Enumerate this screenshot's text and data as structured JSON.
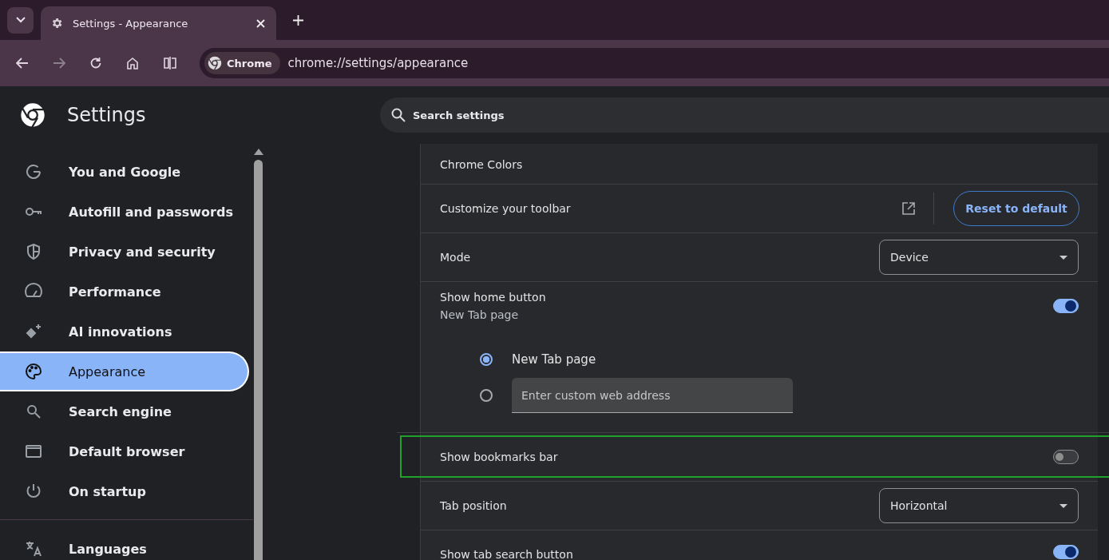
{
  "tab_strip": {
    "tabs": [
      {
        "title": "Settings - Appearance",
        "selected": true
      }
    ]
  },
  "toolbar": {
    "site_chip": "Chrome",
    "url": "chrome://settings/appearance"
  },
  "header": {
    "title": "Settings",
    "search": {
      "placeholder": "Search settings"
    }
  },
  "sidebar": {
    "groups": [
      {
        "items": [
          {
            "label": "You and Google",
            "selected": false
          },
          {
            "label": "Autofill and passwords",
            "selected": false
          },
          {
            "label": "Privacy and security",
            "selected": false
          },
          {
            "label": "Performance",
            "selected": false
          },
          {
            "label": "AI innovations",
            "selected": false
          },
          {
            "label": "Appearance",
            "selected": true
          },
          {
            "label": "Search engine",
            "selected": false
          },
          {
            "label": "Default browser",
            "selected": false
          },
          {
            "label": "On startup",
            "selected": false
          }
        ]
      },
      {
        "items": [
          {
            "label": "Languages",
            "selected": false
          }
        ]
      }
    ]
  },
  "settings": [
    {
      "kind": "label",
      "label": "Chrome Colors"
    },
    {
      "kind": "external",
      "label": "Customize your toolbar",
      "button": "Reset to default"
    },
    {
      "kind": "dropdown",
      "label": "Mode",
      "value": "Device"
    },
    {
      "kind": "toggle",
      "label": "Show home button",
      "sublabel": "New Tab page",
      "on": true,
      "options": [
        {
          "label": "New Tab page",
          "selected": true
        },
        {
          "placeholder": "Enter custom web address",
          "selected": false
        }
      ]
    },
    {
      "kind": "toggle",
      "label": "Show bookmarks bar",
      "on": false,
      "highlighted": true
    },
    {
      "kind": "dropdown",
      "label": "Tab position",
      "value": "Horizontal"
    },
    {
      "kind": "toggle",
      "label": "Show tab search button",
      "on": true
    }
  ]
}
